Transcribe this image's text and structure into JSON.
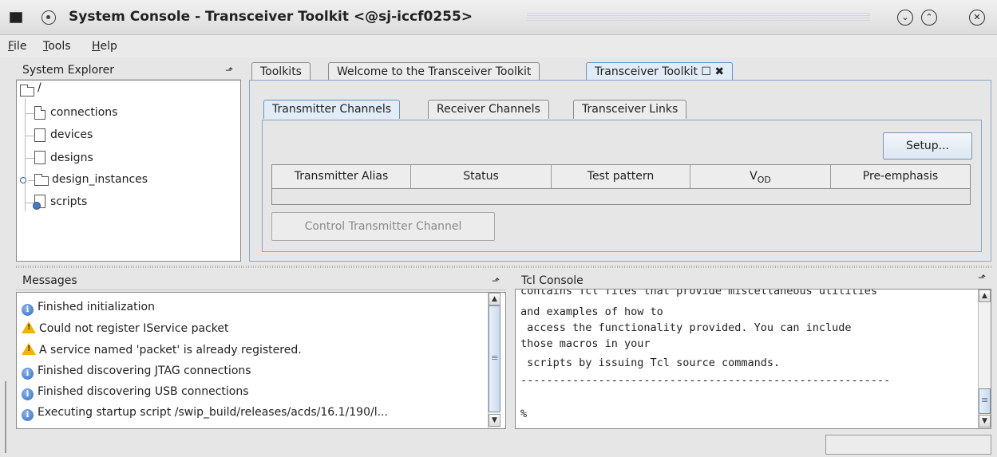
{
  "window": {
    "title": "System Console - Transceiver Toolkit <@sj-iccf0255>",
    "controls": {
      "minimize": "⌄",
      "maximize": "⌃",
      "close": "✕"
    }
  },
  "menu": {
    "file": {
      "mnemonic": "F",
      "rest": "ile"
    },
    "tools": {
      "mnemonic": "T",
      "rest": "ools"
    },
    "help": {
      "mnemonic": "H",
      "rest": "elp"
    }
  },
  "explorer": {
    "title": "System Explorer",
    "root": "/",
    "items": [
      "connections",
      "devices",
      "designs",
      "design_instances",
      "scripts"
    ]
  },
  "main_tabs": [
    {
      "label": "Toolkits"
    },
    {
      "label": "Welcome to the Transceiver Toolkit"
    },
    {
      "label": "Transceiver Toolkit ☐ ✖",
      "active": true
    }
  ],
  "sub_tabs": [
    {
      "label": "Transmitter Channels",
      "active": true
    },
    {
      "label": "Receiver Channels"
    },
    {
      "label": "Transceiver Links"
    }
  ],
  "transmitter": {
    "setup_label": "Setup...",
    "columns": [
      "Transmitter Alias",
      "Status",
      "Test pattern",
      "V",
      "Pre-emphasis"
    ],
    "vod_sub": "OD",
    "control_label": "Control Transmitter Channel"
  },
  "messages": {
    "title": "Messages",
    "rows": [
      {
        "icon": "info-icon",
        "text": "Finished initialization"
      },
      {
        "icon": "warning-icon",
        "text": "Could not register IService packet"
      },
      {
        "icon": "warning-icon",
        "text": "A service named 'packet' is already registered."
      },
      {
        "icon": "info-icon",
        "text": "Finished discovering JTAG connections"
      },
      {
        "icon": "info-icon",
        "text": "Finished discovering USB connections"
      },
      {
        "icon": "info-icon",
        "text": "Executing startup script /swip_build/releases/acds/16.1/190/l..."
      }
    ]
  },
  "tcl": {
    "title": "Tcl Console",
    "lines": [
      "contains Tcl files that provide miscellaneous utilities",
      "and examples of how to",
      " access the functionality provided. You can include",
      "those macros in your",
      " scripts by issuing Tcl source commands.",
      "---------------------------------------------------------",
      "",
      "%"
    ]
  }
}
